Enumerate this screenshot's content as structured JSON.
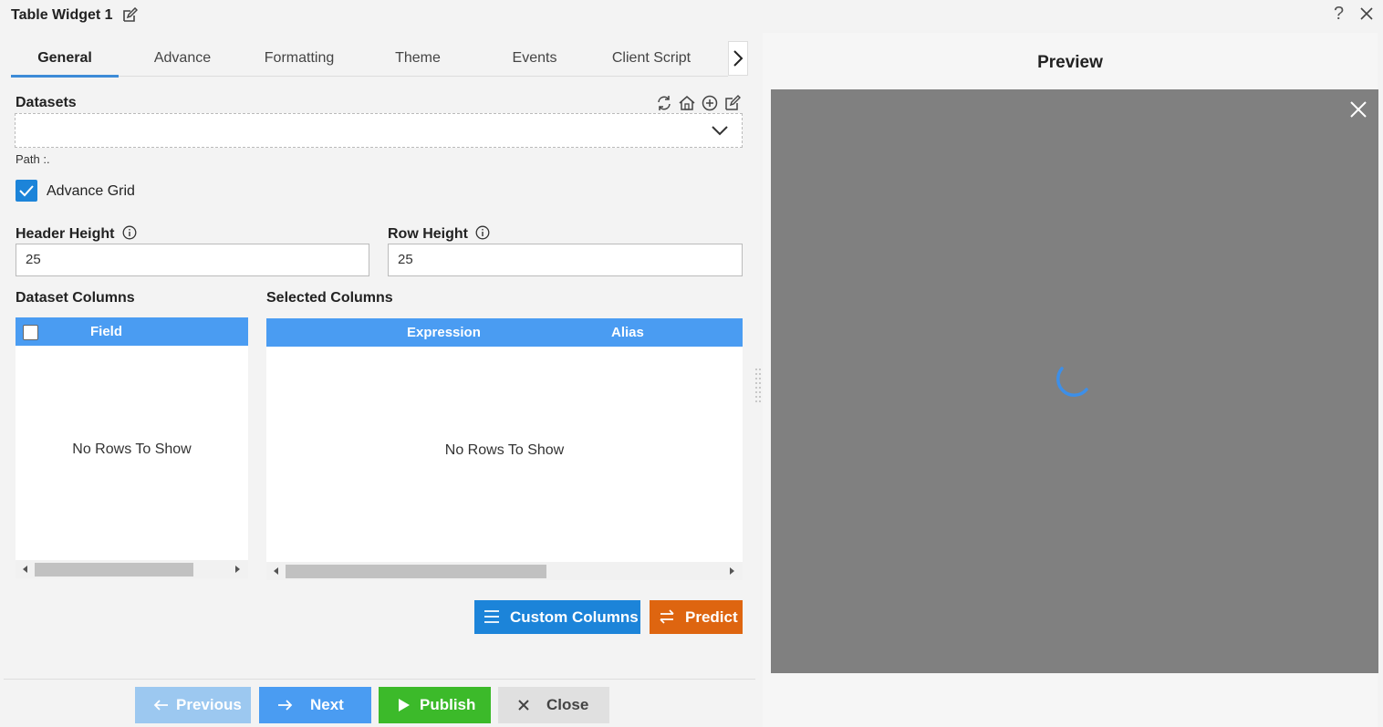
{
  "window": {
    "title": "Table Widget 1",
    "help_label": "?"
  },
  "tabs": [
    {
      "label": "General",
      "active": true
    },
    {
      "label": "Advance"
    },
    {
      "label": "Formatting"
    },
    {
      "label": "Theme"
    },
    {
      "label": "Events"
    },
    {
      "label": "Client Script"
    }
  ],
  "datasets": {
    "label": "Datasets",
    "value": "",
    "path_label": "Path :."
  },
  "advance_grid": {
    "label": "Advance Grid",
    "checked": true
  },
  "header_height": {
    "label": "Header Height",
    "value": "25"
  },
  "row_height": {
    "label": "Row Height",
    "value": "25"
  },
  "dataset_columns": {
    "label": "Dataset Columns",
    "header": "Field",
    "empty_text": "No Rows To Show"
  },
  "selected_columns": {
    "label": "Selected Columns",
    "headers": [
      "Expression",
      "Alias"
    ],
    "empty_text": "No Rows To Show"
  },
  "actions": {
    "custom_columns": "Custom Columns",
    "predict": "Predict"
  },
  "footer": {
    "previous": "Previous",
    "next": "Next",
    "publish": "Publish",
    "close": "Close"
  },
  "preview": {
    "title": "Preview"
  },
  "colors": {
    "accent": "#1c84d9",
    "grid_header": "#4a9cf2",
    "predict": "#de6510",
    "publish": "#3cba2a",
    "previous_disabled": "#9cc8f0",
    "next": "#4a9cf2",
    "close": "#e0e0e0",
    "preview_bg": "#808080"
  }
}
